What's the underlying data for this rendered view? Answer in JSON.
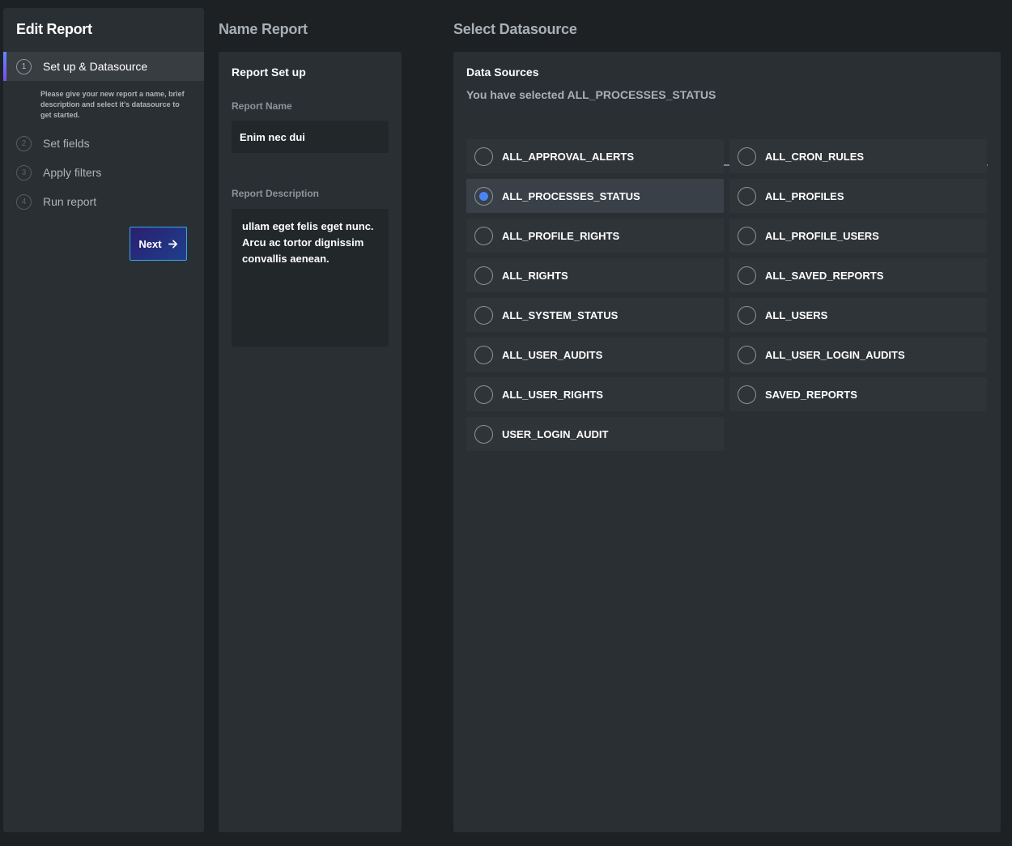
{
  "sidebar": {
    "title": "Edit Report",
    "steps": [
      {
        "num": "1",
        "label": "Set up & Datasource",
        "active": true
      },
      {
        "num": "2",
        "label": "Set fields",
        "active": false
      },
      {
        "num": "3",
        "label": "Apply filters",
        "active": false
      },
      {
        "num": "4",
        "label": "Run report",
        "active": false
      }
    ],
    "step_description": "Please give your new report a name, brief description and select it's datasource to get started.",
    "next_label": "Next"
  },
  "name_report": {
    "section_title": "Name Report",
    "panel_title": "Report Set up",
    "name_label": "Report Name",
    "name_value": "Enim nec dui",
    "description_label": "Report Description",
    "description_value": "ullam eget felis eget nunc. Arcu ac tortor dignissim convallis aenean."
  },
  "datasource": {
    "section_title": "Select Datasource",
    "panel_title": "Data Sources",
    "selected_text": "You have selected ALL_PROCESSES_STATUS",
    "items": [
      {
        "label": "ALL_APPROVAL_ALERTS",
        "selected": false
      },
      {
        "label": "ALL_CRON_RULES",
        "selected": false
      },
      {
        "label": "ALL_PROCESSES_STATUS",
        "selected": true
      },
      {
        "label": "ALL_PROFILES",
        "selected": false
      },
      {
        "label": "ALL_PROFILE_RIGHTS",
        "selected": false
      },
      {
        "label": "ALL_PROFILE_USERS",
        "selected": false
      },
      {
        "label": "ALL_RIGHTS",
        "selected": false
      },
      {
        "label": "ALL_SAVED_REPORTS",
        "selected": false
      },
      {
        "label": "ALL_SYSTEM_STATUS",
        "selected": false
      },
      {
        "label": "ALL_USERS",
        "selected": false
      },
      {
        "label": "ALL_USER_AUDITS",
        "selected": false
      },
      {
        "label": "ALL_USER_LOGIN_AUDITS",
        "selected": false
      },
      {
        "label": "ALL_USER_RIGHTS",
        "selected": false
      },
      {
        "label": "SAVED_REPORTS",
        "selected": false
      },
      {
        "label": "USER_LOGIN_AUDIT",
        "selected": false
      }
    ]
  },
  "colors": {
    "accent": "#4a83f5",
    "background": "#1e2124",
    "panel": "#2a2f33"
  }
}
